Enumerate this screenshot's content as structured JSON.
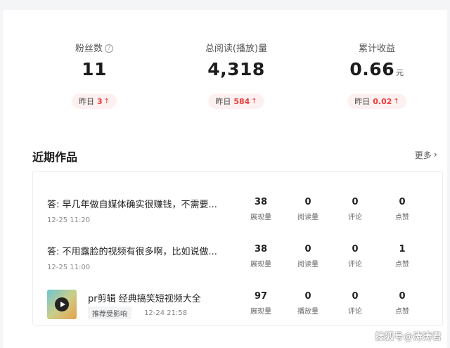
{
  "stats": [
    {
      "label": "粉丝数",
      "value": "11",
      "unit": "",
      "yesterday_label": "昨日",
      "delta": "3",
      "has_help": true
    },
    {
      "label": "总阅读(播放)量",
      "value": "4,318",
      "unit": "",
      "yesterday_label": "昨日",
      "delta": "584",
      "has_help": false
    },
    {
      "label": "累计收益",
      "value": "0.66",
      "unit": "元",
      "yesterday_label": "昨日",
      "delta": "0.02",
      "has_help": false
    }
  ],
  "help_icon_glyph": "?",
  "arrow_glyph": "↑",
  "section": {
    "title": "近期作品",
    "more_label": "更多",
    "more_chevron": "›"
  },
  "works": [
    {
      "title": "答: 早几年做自媒体确实很赚钱，不需要...",
      "date": "12-25 11:20",
      "metrics": [
        {
          "value": "38",
          "label": "展现量"
        },
        {
          "value": "0",
          "label": "阅读量"
        },
        {
          "value": "0",
          "label": "评论"
        },
        {
          "value": "0",
          "label": "点赞"
        }
      ]
    },
    {
      "title": "答: 不用露脸的视频有很多啊，比如说做...",
      "date": "12-25 11:00",
      "metrics": [
        {
          "value": "38",
          "label": "展现量"
        },
        {
          "value": "0",
          "label": "阅读量"
        },
        {
          "value": "0",
          "label": "评论"
        },
        {
          "value": "1",
          "label": "点赞"
        }
      ]
    },
    {
      "title": "pr剪辑 经典搞笑短视频大全",
      "tag": "推荐受影响",
      "date": "12-24 21:58",
      "metrics": [
        {
          "value": "97",
          "label": "展现量"
        },
        {
          "value": "0",
          "label": "播放量"
        },
        {
          "value": "0",
          "label": "评论"
        },
        {
          "value": "0",
          "label": "点赞"
        }
      ]
    }
  ],
  "watermark": "搜狐号@涛涛君",
  "colors": {
    "accent_red": "#ee3a3a",
    "pill_bg": "#fdf0f0",
    "page_bg": "#f4f5f7"
  }
}
